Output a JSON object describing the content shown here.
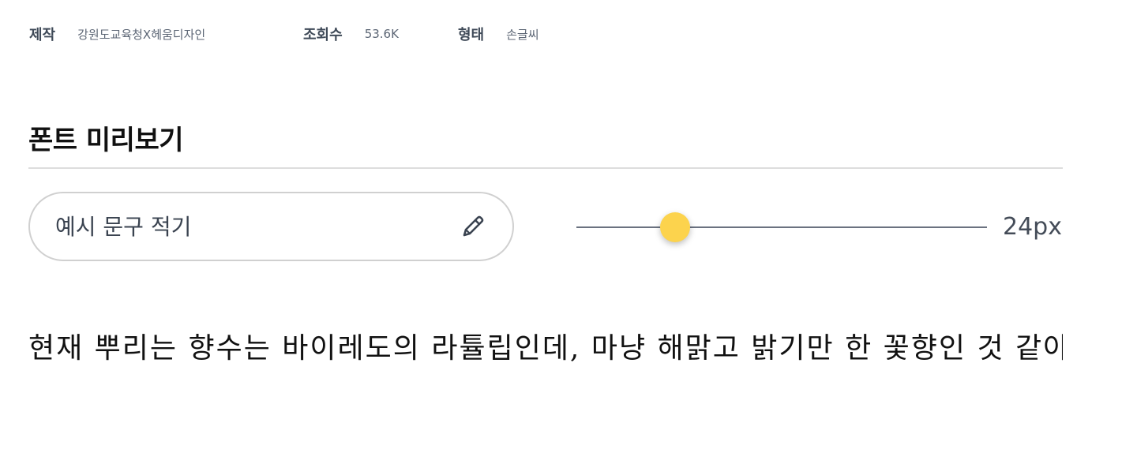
{
  "meta": {
    "maker_label": "제작",
    "maker_value": "강원도교육청X헤움디자인",
    "views_label": "조회수",
    "views_value": "53.6K",
    "type_label": "형태",
    "type_value": "손글씨"
  },
  "section": {
    "title": "폰트 미리보기"
  },
  "sample_input": {
    "placeholder": "예시 문구 적기",
    "value": "",
    "edit_icon": "pencil-icon"
  },
  "font_size_slider": {
    "value_label": "24px",
    "level": 0.24
  },
  "preview": {
    "text": "현재 뿌리는 향수는 바이레도의 라튤립인데, 마냥 해맑고 밝기만 한 꽃향인 것 같아,"
  },
  "colors": {
    "thumb": "#fcd34d",
    "track": "#6b7280",
    "divider": "#dddddd"
  }
}
